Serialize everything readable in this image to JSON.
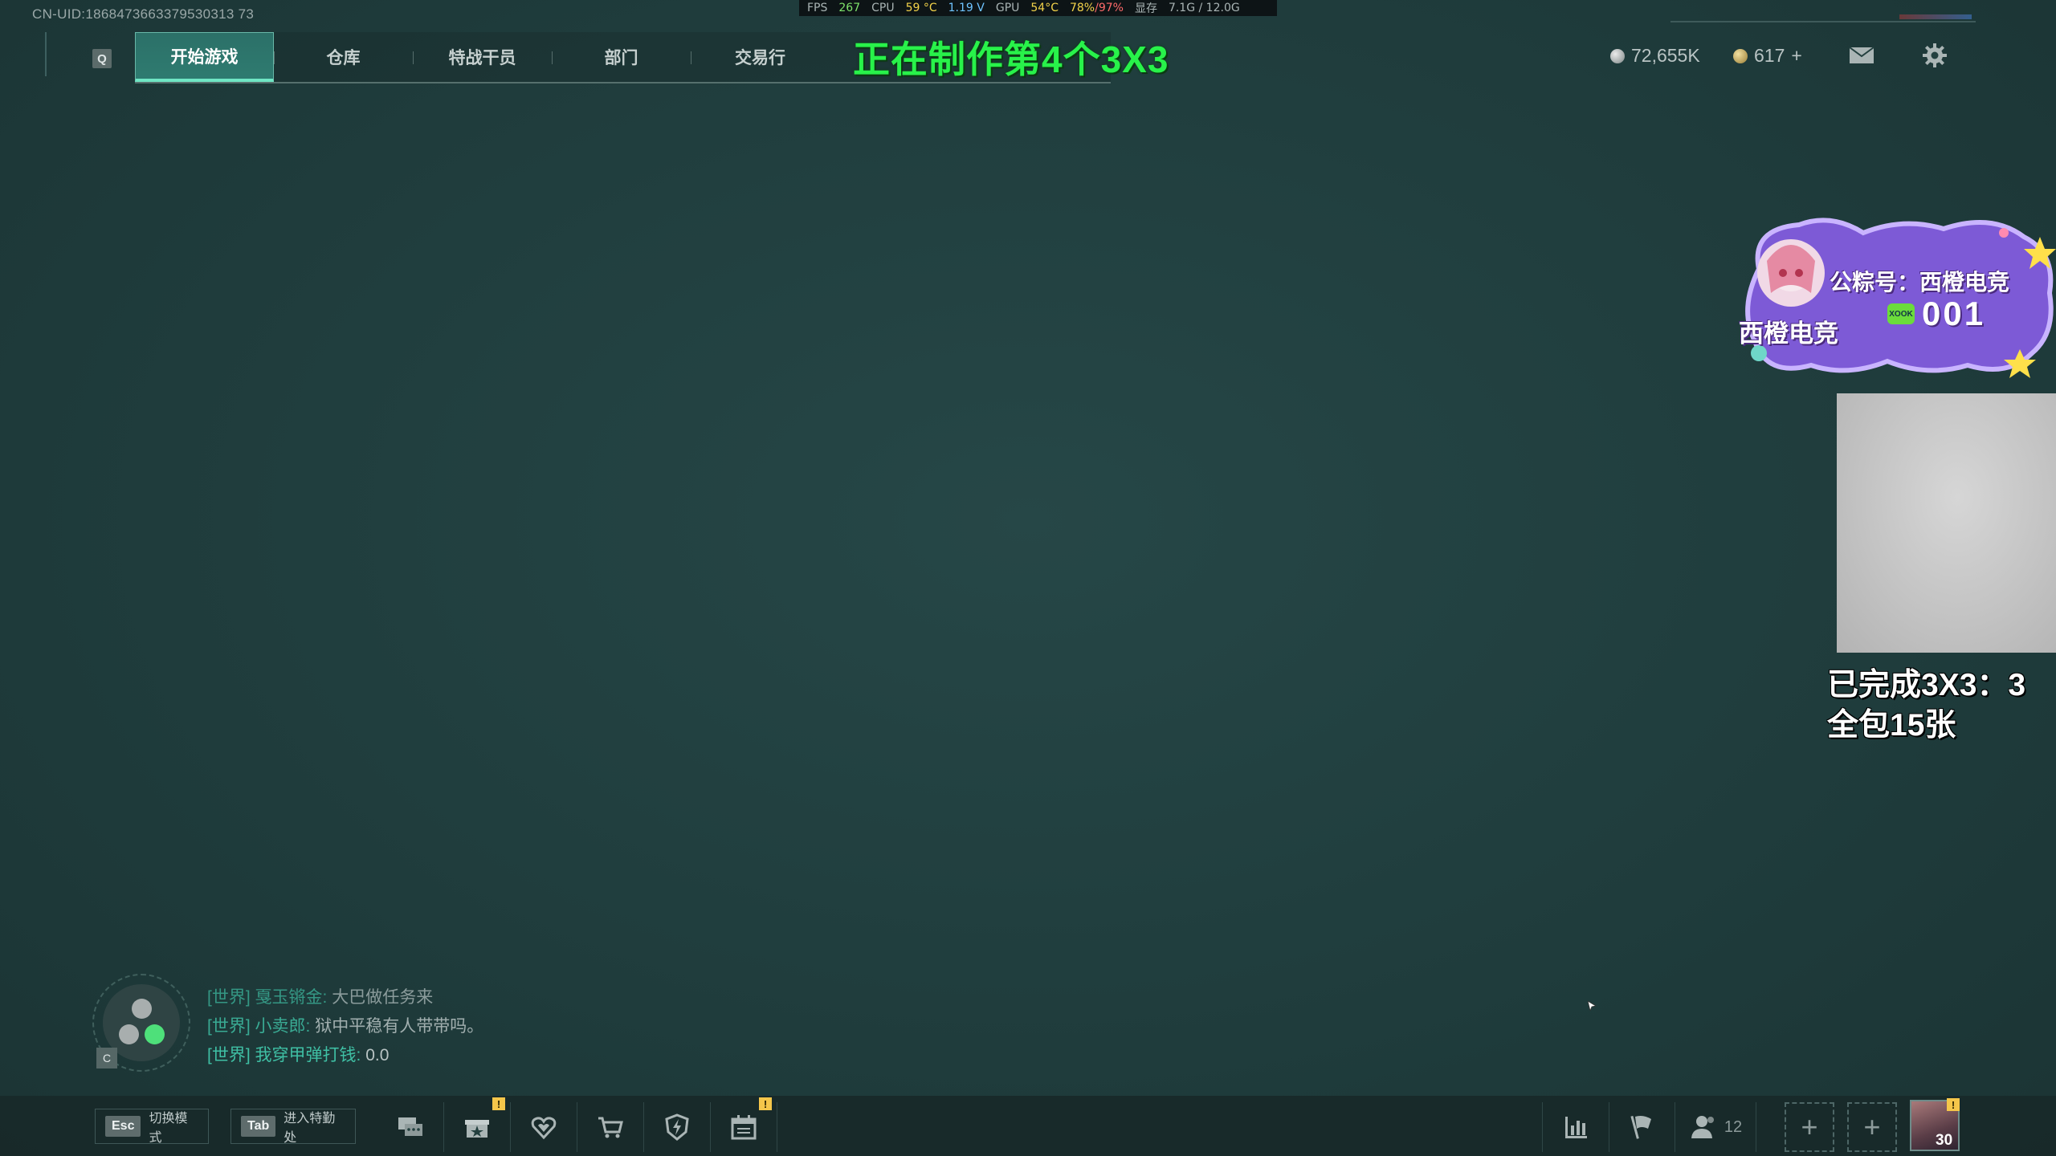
{
  "perf": {
    "fps_label": "FPS",
    "fps": "267",
    "cpu_label": "CPU",
    "cpu_temp": "59 °C",
    "cpu_volt": "1.19 V",
    "gpu_label": "GPU",
    "gpu_temp": "54°C",
    "gpu_load": "78%",
    "gpu_load2": "/97%",
    "vram_label": "显存",
    "vram": "7.1G / 12.0G"
  },
  "uid": "CN-UID:1868473663379530313 73",
  "nav": {
    "q_key": "Q",
    "tabs": [
      {
        "label": "开始游戏",
        "active": true
      },
      {
        "label": "仓库"
      },
      {
        "label": "特战干员"
      },
      {
        "label": "部门"
      },
      {
        "label": "交易行"
      }
    ]
  },
  "banner": "正在制作第4个3X3",
  "currency": {
    "silver": "72,655K",
    "gold": "617",
    "gold_plus": "+"
  },
  "icons": {
    "mail": "mail-icon",
    "settings": "gear-icon"
  },
  "streamer_badge": {
    "handle": "公粽号：西橙电竞",
    "name": "西橙电竞",
    "number": "001",
    "tag": "XOOK"
  },
  "progress": {
    "line1": "已完成3X3：3",
    "line2": "全包15张"
  },
  "voice": {
    "key": "C"
  },
  "chat": [
    {
      "channel": "[世界]",
      "name": "戛玉锵金:",
      "text": "大巴做任务来"
    },
    {
      "channel": "[世界]",
      "name": "小卖郎:",
      "text": "狱中平稳有人带带吗。"
    },
    {
      "channel": "[世界]",
      "name": "我穿甲弹打钱:",
      "text": "0.0"
    }
  ],
  "bottom": {
    "esc_key": "Esc",
    "esc_label": "切换模式",
    "tab_key": "Tab",
    "tab_label": "进入特勤处",
    "alert": "!",
    "friends_count": "12",
    "add": "+",
    "avatar_level": "30"
  },
  "colors": {
    "accent": "#6fe6c4",
    "banner": "#28f24a",
    "alert": "#f5c64a"
  }
}
